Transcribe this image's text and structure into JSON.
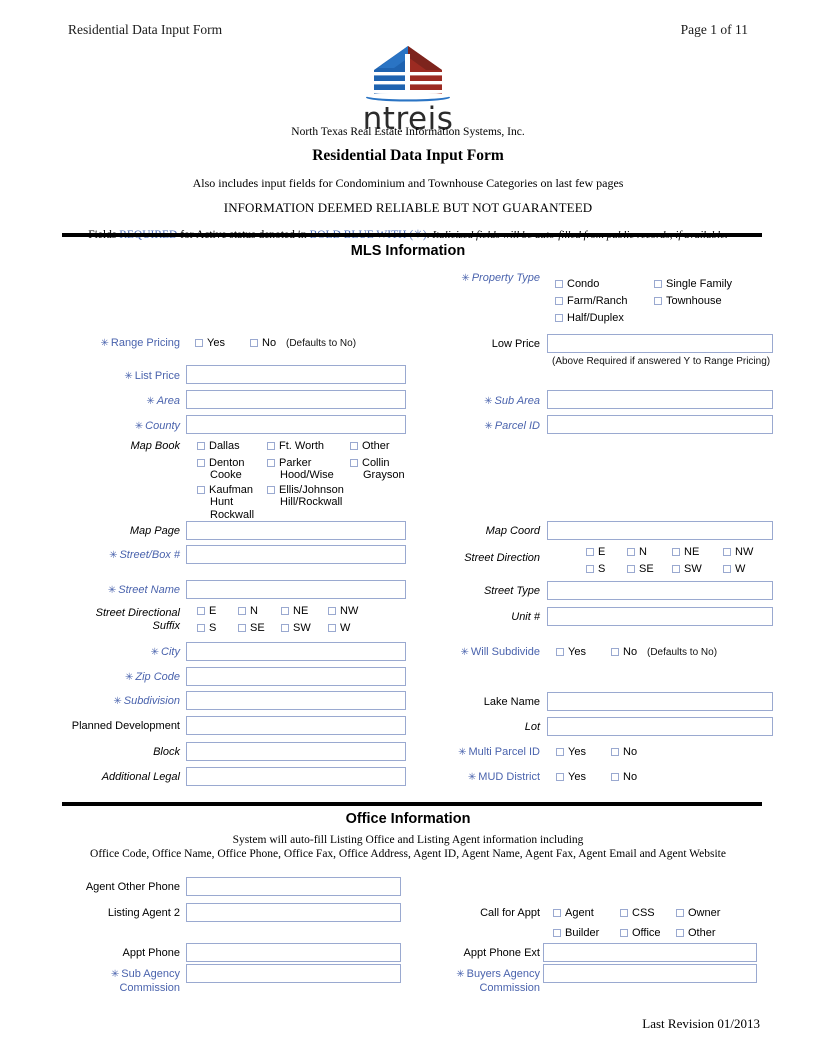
{
  "running_header": {
    "left": "Residential Data Input Form",
    "right": "Page 1 of 11"
  },
  "logo": {
    "wordmark": "ntreis",
    "mark_name": "ntreis-building-logo",
    "colors": {
      "blue": "#1f63b0",
      "red": "#9c2b22",
      "dark_red": "#7d241d"
    }
  },
  "title_block": {
    "company": "North Texas Real Estate Information Systems, Inc.",
    "form_name": "Residential Data Input Form",
    "also_includes": "Also includes input fields for Condominium and Townhouse Categories on last few pages",
    "deemed": "INFORMATION DEEMED RELIABLE BUT NOT GUARANTEED",
    "required_line": {
      "part1": "Fields ",
      "required": "REQUIRED",
      "part2": " for Active status denoted in ",
      "bold_blue": "BOLD BLUE WITH (✳)",
      "part3": ".  ",
      "italic_note": "Italicized fields will be auto-filled from public records, if available."
    },
    "blue_color": "#4a6ab5"
  },
  "sections": {
    "mls": {
      "title": "MLS Information"
    },
    "office": {
      "title": "Office Information",
      "note_line1": "System will auto-fill Listing Office and Listing Agent information including",
      "note_line2": "Office Code, Office Name, Office Phone, Office Fax, Office Address, Agent ID, Agent Name, Agent Fax, Agent Email and Agent Website"
    }
  },
  "labels": {
    "property_type": "Property Type",
    "range_pricing": "Range Pricing",
    "list_price": "List Price",
    "area": "Area",
    "county": "County",
    "map_book": "Map Book",
    "map_page": "Map Page",
    "street_box": "Street/Box #",
    "street_name": "Street Name",
    "street_directional_suffix_l1": "Street Directional",
    "street_directional_suffix_l2": "Suffix",
    "city": "City",
    "zip_code": "Zip Code",
    "subdivision": "Subdivision",
    "planned_development": "Planned Development",
    "block": "Block",
    "additional_legal": "Additional Legal",
    "low_price": "Low Price",
    "low_price_note": "(Above Required if answered Y to Range Pricing)",
    "sub_area": "Sub Area",
    "parcel_id": "Parcel ID",
    "map_coord": "Map Coord",
    "street_direction": "Street Direction",
    "street_type": "Street Type",
    "unit_number": "Unit #",
    "will_subdivide": "Will Subdivide",
    "lake_name": "Lake Name",
    "lot": "Lot",
    "multi_parcel_id": "Multi Parcel ID",
    "mud_district": "MUD District",
    "agent_other_phone": "Agent Other Phone",
    "listing_agent_2": "Listing Agent 2",
    "appt_phone": "Appt Phone",
    "sub_agency_l1": "Sub Agency",
    "sub_agency_l2": "Commission",
    "call_for_appt": "Call for Appt",
    "appt_phone_ext": "Appt Phone Ext",
    "buyers_agency_l1": "Buyers  Agency",
    "buyers_agency_l2": "Commission"
  },
  "options": {
    "property_type_col1": [
      "Condo",
      "Farm/Ranch",
      "Half/Duplex"
    ],
    "property_type_col2": [
      "Single Family",
      "Townhouse"
    ],
    "yes": "Yes",
    "no": "No",
    "defaults_to_no": "(Defaults to No)",
    "map_book_col1": [
      {
        "line1": "Dallas"
      },
      {
        "line1": "Denton",
        "line2": "Cooke"
      },
      {
        "line1": "Kaufman",
        "line2": "Hunt",
        "line3": "Rockwall"
      }
    ],
    "map_book_col2": [
      {
        "line1": "Ft. Worth"
      },
      {
        "line1": "Parker",
        "line2": "Hood/Wise"
      },
      {
        "line1": "Ellis/Johnson",
        "line2": "Hill/Rockwall"
      }
    ],
    "map_book_col3": [
      {
        "line1": "Other"
      },
      {
        "line1": "Collin",
        "line2": "Grayson"
      }
    ],
    "directions_row1": [
      "E",
      "N",
      "NE",
      "NW"
    ],
    "directions_row2": [
      "S",
      "SE",
      "SW",
      "W"
    ],
    "call_for_appt_row1": [
      "Agent",
      "CSS",
      "Owner"
    ],
    "call_for_appt_row2": [
      "Builder",
      "Office",
      "Other"
    ]
  },
  "values": {
    "list_price": "",
    "area": "",
    "county": "",
    "map_page": "",
    "street_box": "",
    "street_name": "",
    "city": "",
    "zip_code": "",
    "subdivision": "",
    "planned_development": "",
    "block": "",
    "additional_legal": "",
    "low_price": "",
    "sub_area": "",
    "parcel_id": "",
    "map_coord": "",
    "street_type": "",
    "unit_number": "",
    "lake_name": "",
    "lot": "",
    "agent_other_phone": "",
    "listing_agent_2": "",
    "appt_phone": "",
    "sub_agency_commission": "",
    "appt_phone_ext": "",
    "buyers_agency_commission": ""
  },
  "footer": {
    "last_revision": "Last Revision 01/2013"
  }
}
